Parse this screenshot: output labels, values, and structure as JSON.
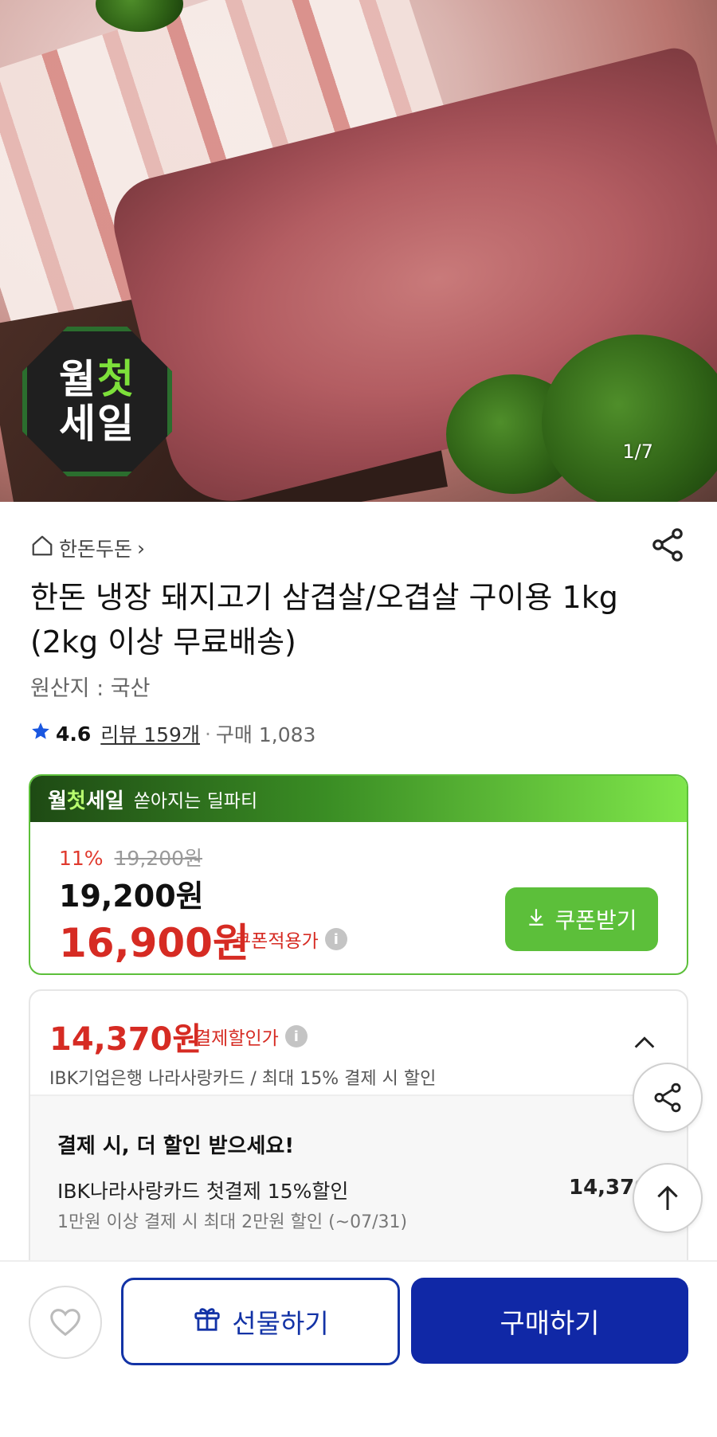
{
  "hero": {
    "badge_line1_a": "월",
    "badge_line1_b": "첫",
    "badge_line2": "세일",
    "counter": "1/7"
  },
  "store": {
    "name": "한돈두돈",
    "chevron": "›"
  },
  "product": {
    "title": "한돈 냉장 돼지고기 삼겹살/오겹살 구이용 1kg (2kg 이상 무료배송)",
    "origin": "원산지 : 국산",
    "rating": "4.6",
    "reviews": "리뷰 159개",
    "purchases": "구매 1,083"
  },
  "deal": {
    "brand_a": "월",
    "brand_b": "첫",
    "brand_c": "세일",
    "subtitle": "쏟아지는 딜파티",
    "discount_rate": "11%",
    "original_price": "19,200원",
    "price": "19,200원",
    "coupon_price": "16,900원",
    "coupon_label": "쿠폰적용가",
    "coupon_button": "쿠폰받기"
  },
  "payment": {
    "price": "14,370원",
    "label": "결제할인가",
    "description": "IBK기업은행 나라사랑카드 / 최대 15% 결제 시 할인",
    "heading": "결제 시, 더 할인 받으세요!",
    "card_title": "IBK나라사랑카드 첫결제 15%할인",
    "card_amount": "14,370",
    "card_note": "1만원 이상 결제 시 최대 2만원 할인 (~07/31)"
  },
  "actions": {
    "gift": "선물하기",
    "buy": "구매하기"
  },
  "colors": {
    "accent_green": "#5cbf3a",
    "price_red": "#d62b23",
    "primary_blue": "#1028a6"
  }
}
